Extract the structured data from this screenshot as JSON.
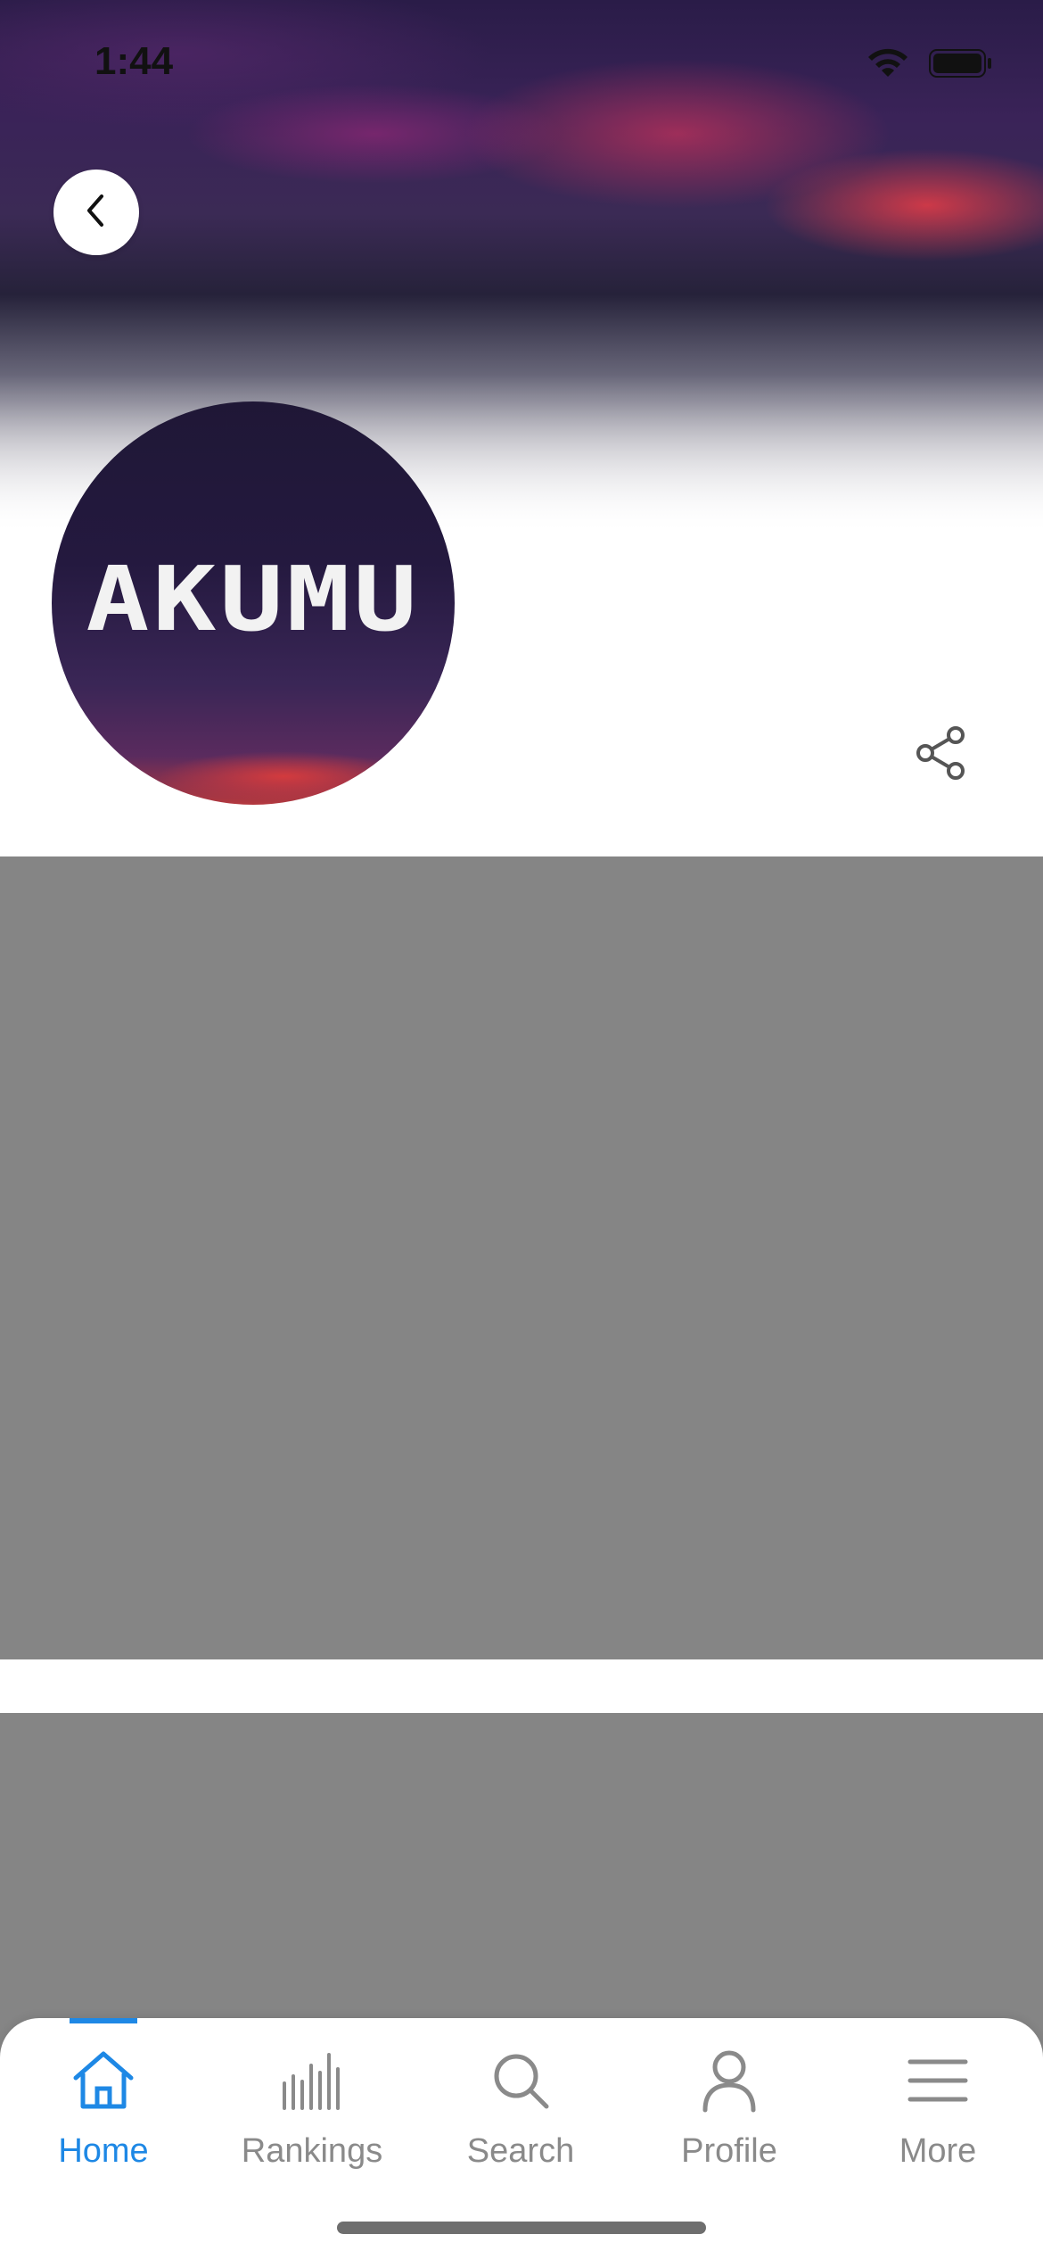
{
  "status_bar": {
    "time": "1:44",
    "wifi_icon": "wifi-icon",
    "battery_icon": "battery-icon"
  },
  "header": {
    "back_icon": "chevron-left-icon",
    "avatar_text": "AKUMU",
    "share_icon": "share-icon"
  },
  "tab_bar": {
    "active_color": "#1e88e5",
    "inactive_color": "#8a8a8a",
    "items": [
      {
        "label": "Home",
        "icon": "home-icon",
        "active": true
      },
      {
        "label": "Rankings",
        "icon": "bars-icon",
        "active": false
      },
      {
        "label": "Search",
        "icon": "search-icon",
        "active": false
      },
      {
        "label": "Profile",
        "icon": "person-icon",
        "active": false
      },
      {
        "label": "More",
        "icon": "menu-icon",
        "active": false
      }
    ]
  },
  "colors": {
    "placeholder": "#858585",
    "accent": "#1e88e5"
  }
}
